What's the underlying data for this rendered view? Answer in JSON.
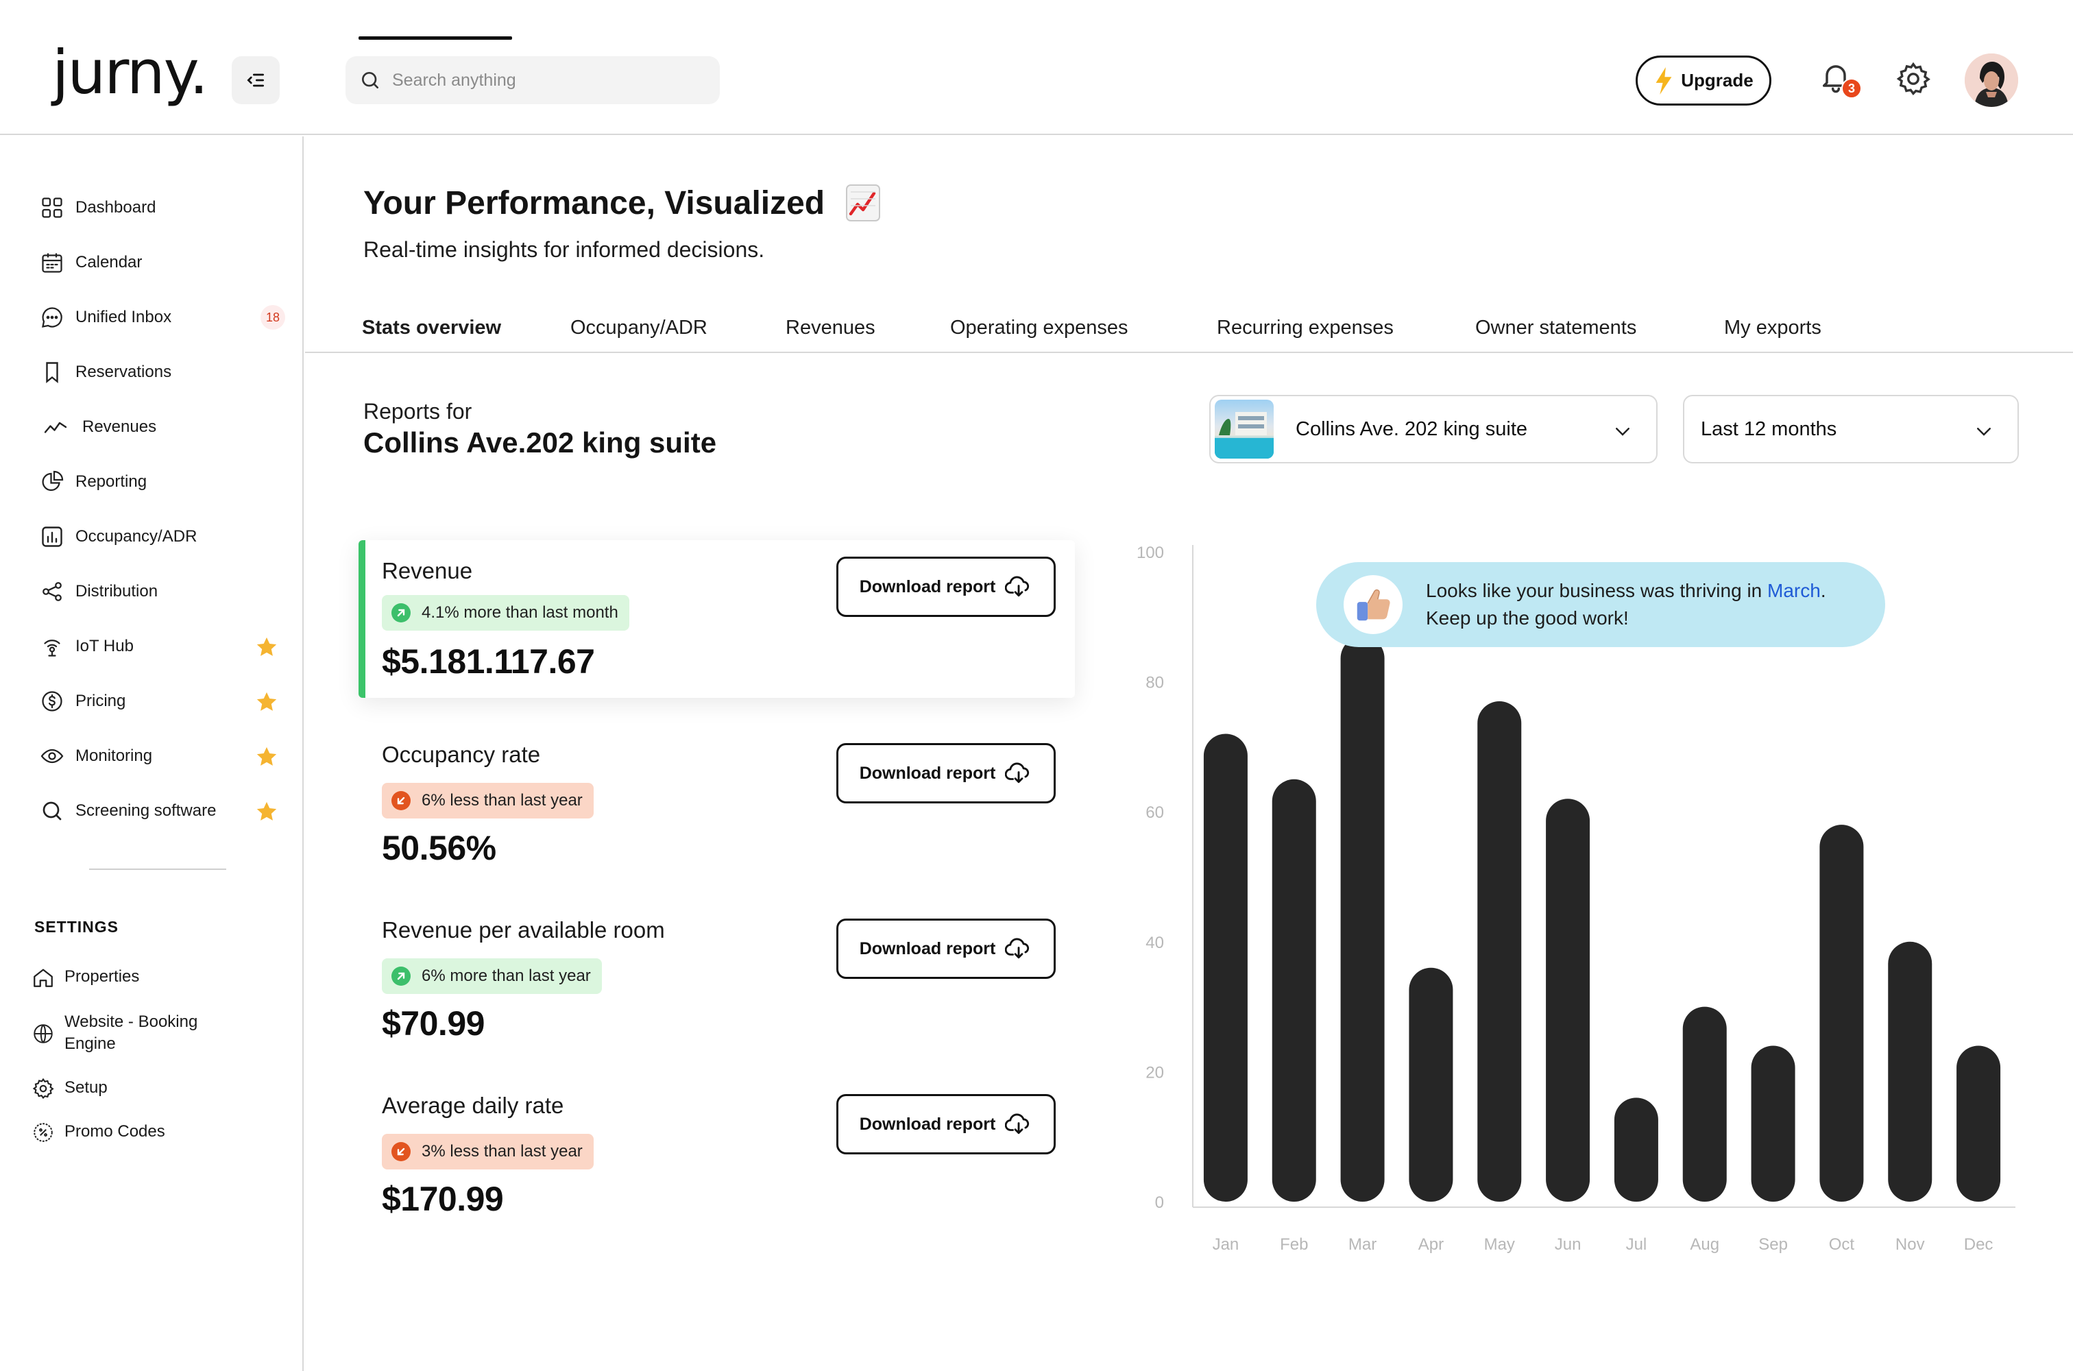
{
  "header": {
    "logo_text": "jurny.",
    "search_placeholder": "Search anything",
    "upgrade_label": "Upgrade",
    "notification_count": "3"
  },
  "sidebar": {
    "items": [
      {
        "label": "Dashboard",
        "icon": "grid-icon"
      },
      {
        "label": "Calendar",
        "icon": "calendar-icon"
      },
      {
        "label": "Unified Inbox",
        "icon": "chat-icon",
        "badge": "18"
      },
      {
        "label": "Reservations",
        "icon": "bookmark-icon"
      },
      {
        "label": "Revenues",
        "icon": "trend-icon"
      },
      {
        "label": "Reporting",
        "icon": "pie-chart-icon"
      },
      {
        "label": "Occupancy/ADR",
        "icon": "bar-chart-icon"
      },
      {
        "label": "Distribution",
        "icon": "share-icon"
      },
      {
        "label": "IoT Hub",
        "icon": "iot-icon",
        "star": true
      },
      {
        "label": "Pricing",
        "icon": "dollar-icon",
        "star": true
      },
      {
        "label": "Monitoring",
        "icon": "eye-icon",
        "star": true
      },
      {
        "label": "Screening software",
        "icon": "search-icon",
        "star": true
      }
    ],
    "settings_title": "SETTINGS",
    "settings_items": [
      {
        "label": "Properties",
        "icon": "home-icon"
      },
      {
        "label_line1": "Website - Booking",
        "label_line2": "Engine",
        "icon": "globe-icon"
      },
      {
        "label": "Setup",
        "icon": "gear-icon"
      },
      {
        "label": "Promo Codes",
        "icon": "percent-icon"
      }
    ]
  },
  "main": {
    "title": "Your Performance, Visualized",
    "subtitle": "Real-time insights for informed decisions.",
    "tabs": [
      {
        "label": "Stats overview",
        "active": true
      },
      {
        "label": "Occupany/ADR"
      },
      {
        "label": "Revenues"
      },
      {
        "label": "Operating expenses"
      },
      {
        "label": "Recurring expenses"
      },
      {
        "label": "Owner statements"
      },
      {
        "label": "My exports"
      }
    ],
    "reports_for_label": "Reports for",
    "property_name": "Collins Ave.202 king suite",
    "property_select": "Collins Ave. 202 king suite",
    "period_select": "Last 12 months",
    "download_label": "Download report",
    "stats": [
      {
        "label": "Revenue",
        "trend": "up",
        "change": "4.1% more than last month",
        "value": "$5.181.117.67"
      },
      {
        "label": "Occupancy rate",
        "trend": "down",
        "change": "6% less than last year",
        "value": "50.56%"
      },
      {
        "label": "Revenue per available room",
        "trend": "up",
        "change": "6% more than last year",
        "value": "$70.99"
      },
      {
        "label": "Average daily rate",
        "trend": "down",
        "change": "3% less than last year",
        "value": "$170.99"
      }
    ],
    "insight": {
      "text_before": "Looks like your business was thriving in ",
      "month": "March",
      "text_after": ".",
      "line2": "Keep up the good work!"
    }
  },
  "colors": {
    "accent_green": "#3cc46a",
    "positive_bg": "#dbf6de",
    "negative_bg": "#fbd6c6",
    "negative_dot": "#e2541f",
    "bar": "#262626",
    "insight_bg": "#bfe8f3",
    "link_blue": "#1f5bd6",
    "star": "#f5b431"
  },
  "chart_data": {
    "type": "bar",
    "categories": [
      "Jan",
      "Feb",
      "Mar",
      "Apr",
      "May",
      "Jun",
      "Jul",
      "Aug",
      "Sep",
      "Oct",
      "Nov",
      "Dec"
    ],
    "values": [
      72,
      65,
      87,
      36,
      77,
      62,
      16,
      30,
      24,
      58,
      40,
      24
    ],
    "yticks": [
      0,
      20,
      40,
      60,
      80,
      100
    ],
    "ylim": [
      0,
      100
    ],
    "grid": false,
    "title": "",
    "xlabel": "",
    "ylabel": ""
  }
}
